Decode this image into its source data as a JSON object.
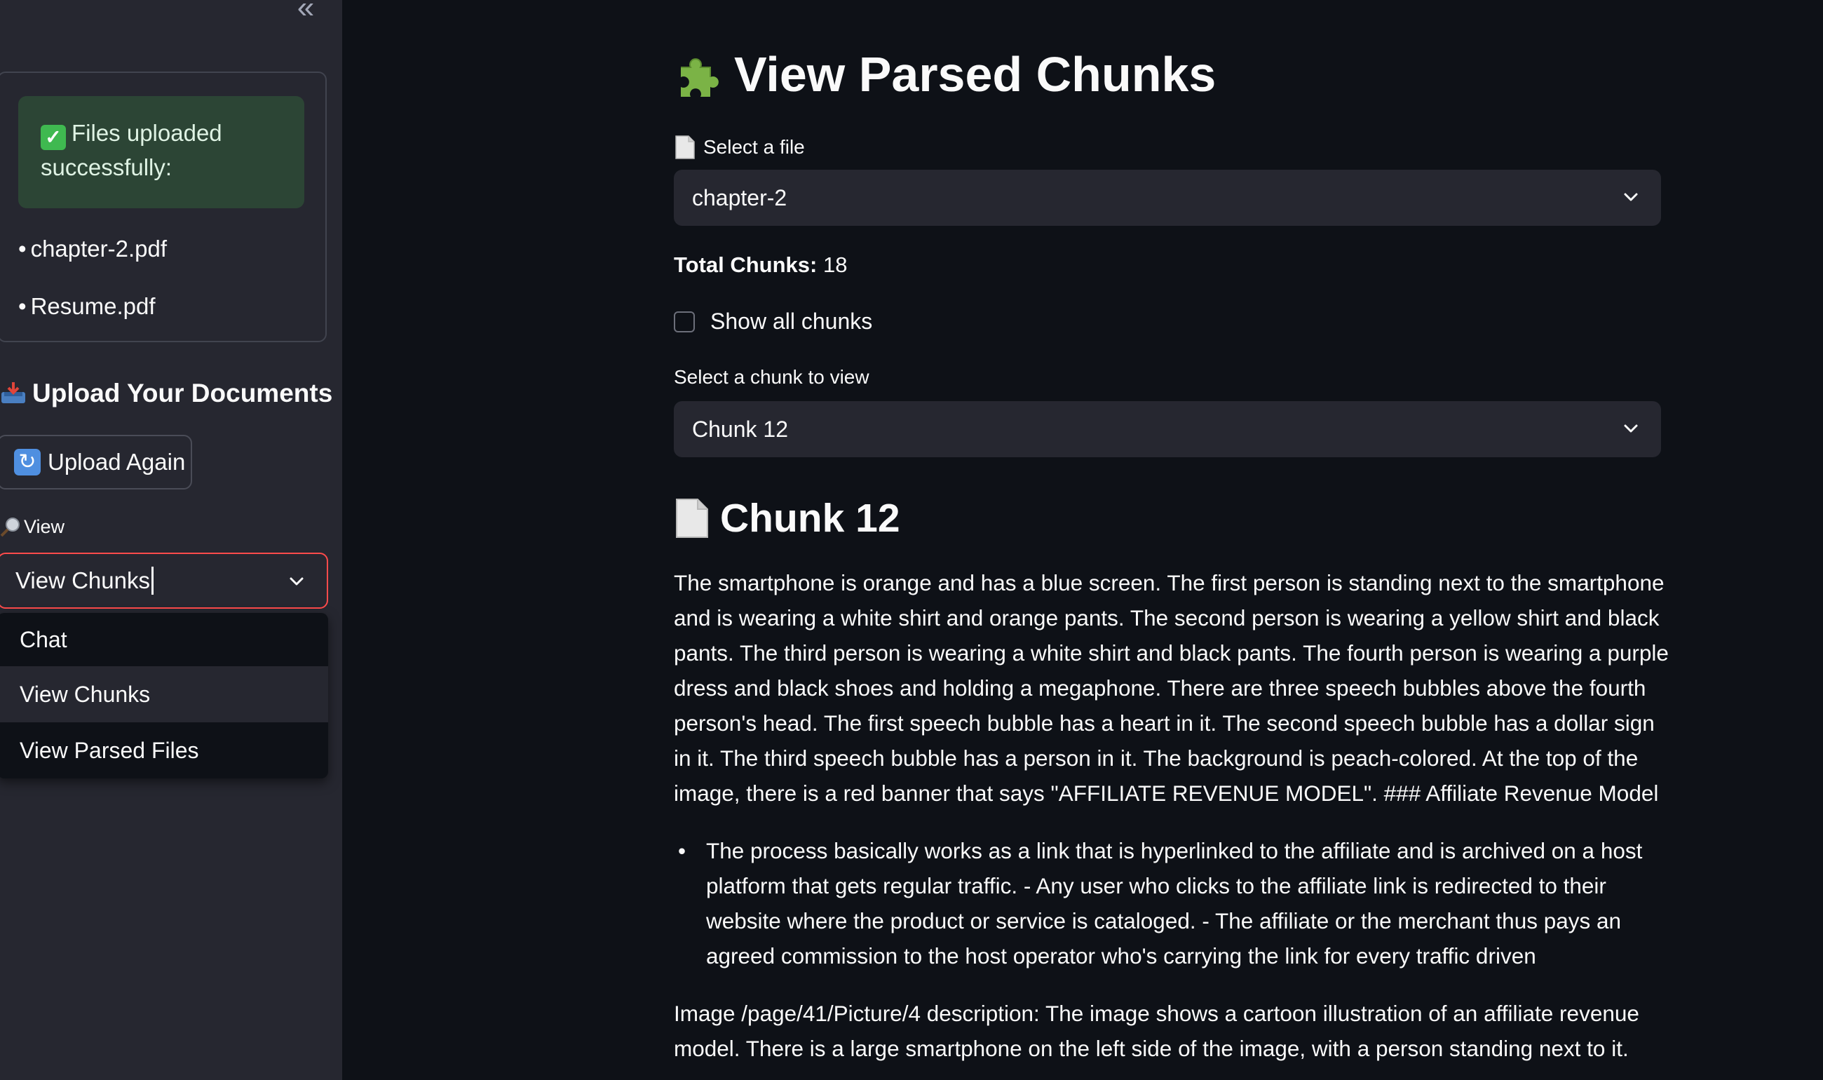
{
  "sidebar": {
    "collapse_icon": "double-chevron-left-icon",
    "success_message": "Files uploaded successfully:",
    "files": [
      "chapter-2.pdf",
      "Resume.pdf"
    ],
    "upload_heading": "Upload Your Documents",
    "upload_again_label": "Upload Again",
    "view_label": "View",
    "view_select_value": "View Chunks",
    "view_options": [
      "Chat",
      "View Chunks",
      "View Parsed Files"
    ]
  },
  "main": {
    "title": "View Parsed Chunks",
    "file_select_label": "Select a file",
    "file_select_value": "chapter-2",
    "total_chunks_label": "Total Chunks:",
    "total_chunks_value": "18",
    "show_all_label": "Show all chunks",
    "show_all_checked": false,
    "chunk_select_label": "Select a chunk to view",
    "chunk_select_value": "Chunk 12",
    "chunk_heading": "Chunk 12",
    "paragraph_1": "The smartphone is orange and has a blue screen. The first person is standing next to the smartphone and is wearing a white shirt and orange pants. The second person is wearing a yellow shirt and black pants. The third person is wearing a white shirt and black pants. The fourth person is wearing a purple dress and black shoes and holding a megaphone. There are three speech bubbles above the fourth person's head. The first speech bubble has a heart in it. The second speech bubble has a dollar sign in it. The third speech bubble has a person in it. The background is peach-colored. At the top of the image, there is a red banner that says \"AFFILIATE REVENUE MODEL\". ### Affiliate Revenue Model",
    "bullet_1": "The process basically works as a link that is hyperlinked to the affiliate and is archived on a host platform that gets regular traffic. - Any user who clicks to the affiliate link is redirected to their website where the product or service is cataloged. - The affiliate or the merchant thus pays an agreed commission to the host operator who's carrying the link for every traffic driven",
    "paragraph_2": "Image /page/41/Picture/4 description: The image shows a cartoon illustration of an affiliate revenue model. There is a large smartphone on the left side of the image, with a person standing next to it."
  },
  "colors": {
    "sidebar_bg": "#262730",
    "main_bg": "#0e1117",
    "success_bg": "#2c4535",
    "focus_border": "#ff4b4b"
  }
}
